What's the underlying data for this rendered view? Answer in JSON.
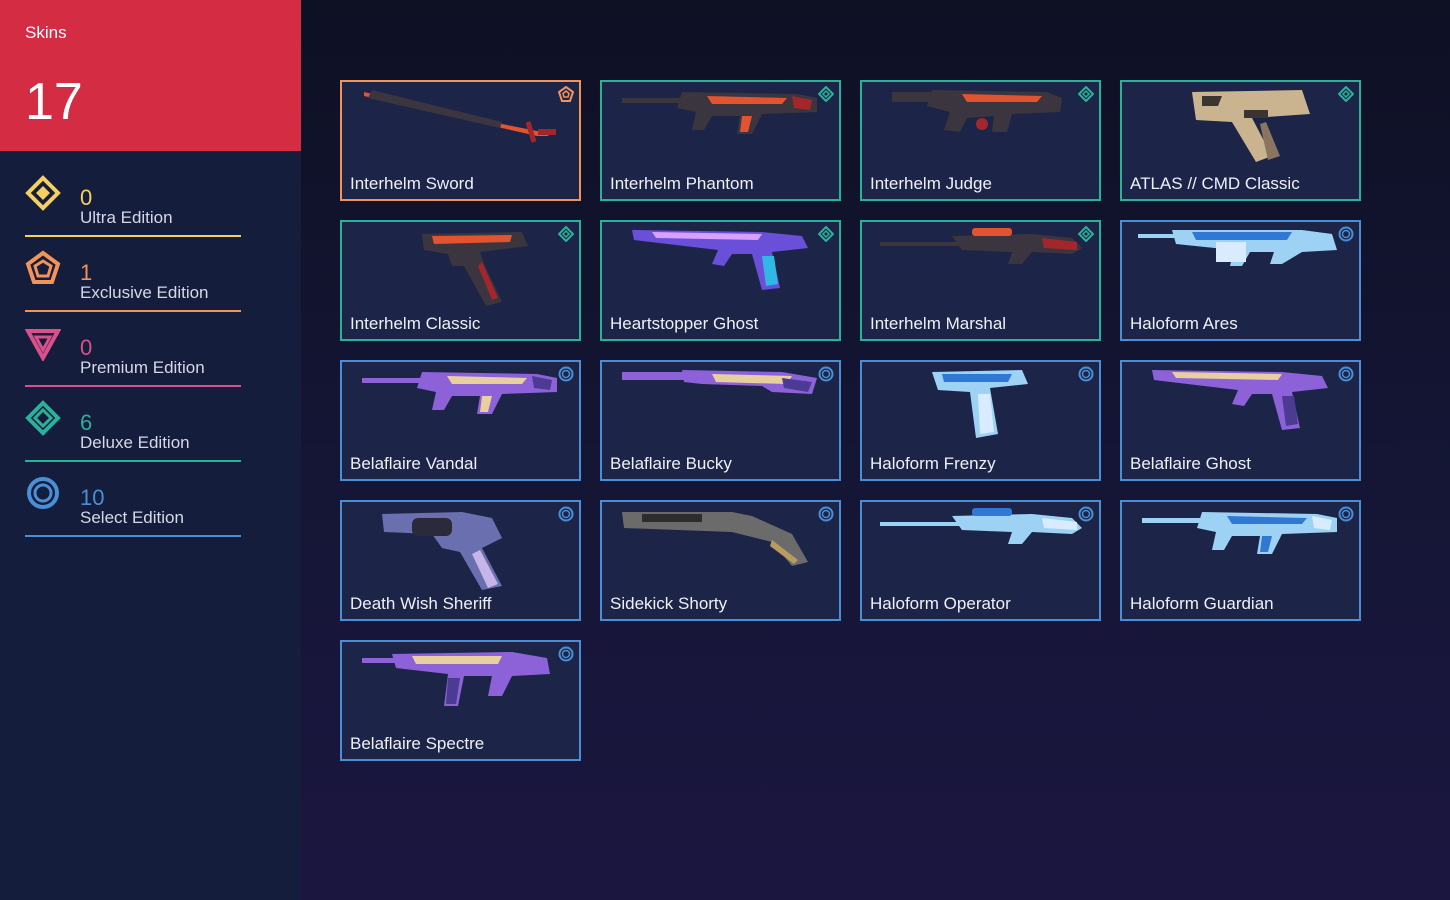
{
  "sidebar": {
    "title": "Skins",
    "total": "17",
    "tiers": [
      {
        "count": "0",
        "label": "Ultra Edition",
        "color": "#f4d061",
        "icon": "ultra-edition-icon"
      },
      {
        "count": "1",
        "label": "Exclusive Edition",
        "color": "#f2935a",
        "icon": "exclusive-edition-icon"
      },
      {
        "count": "0",
        "label": "Premium Edition",
        "color": "#d9508a",
        "icon": "premium-edition-icon"
      },
      {
        "count": "6",
        "label": "Deluxe Edition",
        "color": "#2bb19a",
        "icon": "deluxe-edition-icon"
      },
      {
        "count": "10",
        "label": "Select Edition",
        "color": "#4a8fd6",
        "icon": "select-edition-icon"
      }
    ]
  },
  "skins": [
    {
      "name": "Interhelm Sword",
      "tier": "exclusive",
      "weapon": "melee-sword"
    },
    {
      "name": "Interhelm Phantom",
      "tier": "deluxe",
      "weapon": "rifle"
    },
    {
      "name": "Interhelm Judge",
      "tier": "deluxe",
      "weapon": "shotgun"
    },
    {
      "name": "ATLAS // CMD Classic",
      "tier": "deluxe",
      "weapon": "pistol-block"
    },
    {
      "name": "Interhelm Classic",
      "tier": "deluxe",
      "weapon": "pistol"
    },
    {
      "name": "Heartstopper Ghost",
      "tier": "deluxe",
      "weapon": "pistol-long"
    },
    {
      "name": "Interhelm Marshal",
      "tier": "deluxe",
      "weapon": "sniper"
    },
    {
      "name": "Haloform Ares",
      "tier": "select",
      "weapon": "lmg"
    },
    {
      "name": "Belaflaire Vandal",
      "tier": "select",
      "weapon": "rifle"
    },
    {
      "name": "Belaflaire Bucky",
      "tier": "select",
      "weapon": "shotgun-long"
    },
    {
      "name": "Haloform Frenzy",
      "tier": "select",
      "weapon": "machine-pistol"
    },
    {
      "name": "Belaflaire Ghost",
      "tier": "select",
      "weapon": "pistol-long"
    },
    {
      "name": "Death Wish Sheriff",
      "tier": "select",
      "weapon": "revolver"
    },
    {
      "name": "Sidekick Shorty",
      "tier": "select",
      "weapon": "sawed-off"
    },
    {
      "name": "Haloform Operator",
      "tier": "select",
      "weapon": "sniper"
    },
    {
      "name": "Haloform Guardian",
      "tier": "select",
      "weapon": "rifle"
    },
    {
      "name": "Belaflaire Spectre",
      "tier": "select",
      "weapon": "smg"
    }
  ],
  "colors": {
    "exclusive": "#f2935a",
    "deluxe": "#2bb19a",
    "select": "#4a8fd6",
    "header": "#d42c42"
  }
}
